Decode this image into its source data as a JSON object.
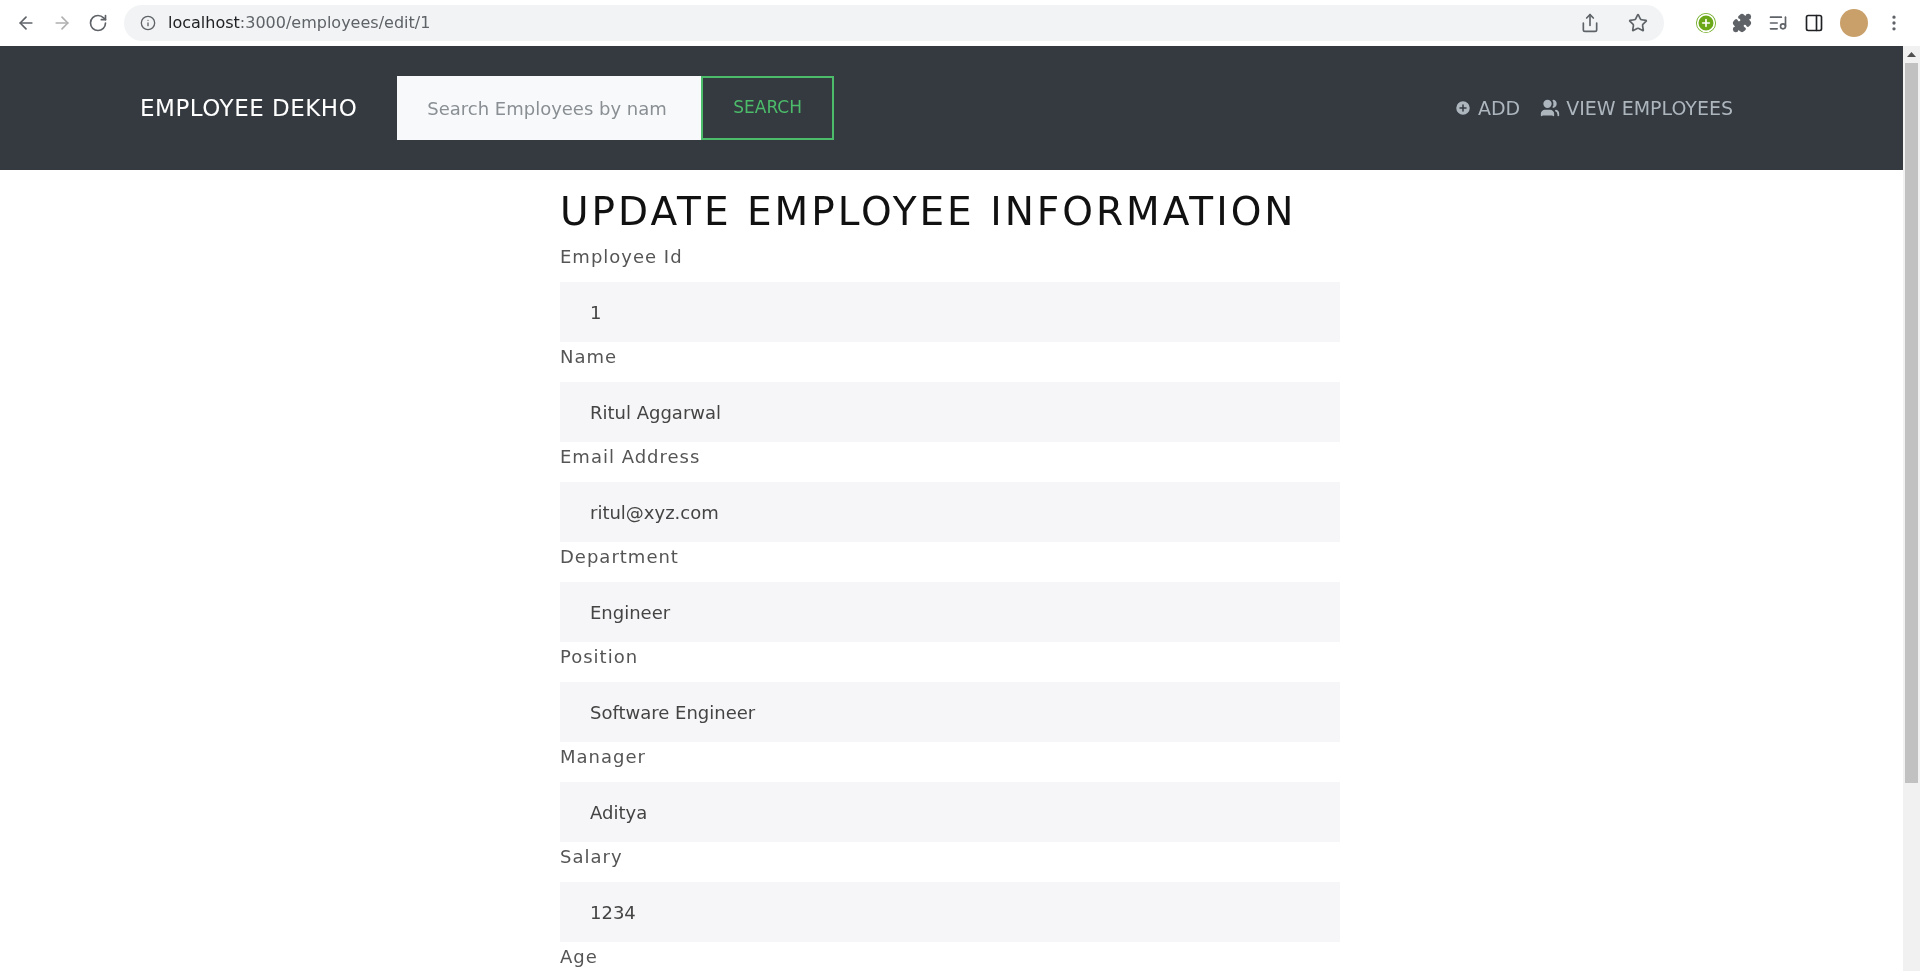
{
  "browser": {
    "url_host": "localhost",
    "url_path": ":3000/employees/edit/1",
    "back_disabled": false,
    "forward_disabled": true
  },
  "navbar": {
    "brand": "EMPLOYEE DEKHO",
    "search": {
      "placeholder": "Search Employees by nam"
    },
    "search_button": "SEARCH",
    "links": [
      {
        "kind": "add",
        "label": "ADD"
      },
      {
        "kind": "people",
        "label": "VIEW EMPLOYEES"
      }
    ]
  },
  "form": {
    "title": "UPDATE EMPLOYEE INFORMATION",
    "fields": [
      {
        "label": "Employee Id",
        "value": "1"
      },
      {
        "label": "Name",
        "value": "Ritul Aggarwal"
      },
      {
        "label": "Email Address",
        "value": "ritul@xyz.com"
      },
      {
        "label": "Department",
        "value": "Engineer"
      },
      {
        "label": "Position",
        "value": "Software Engineer"
      },
      {
        "label": "Manager",
        "value": "Aditya"
      },
      {
        "label": "Salary",
        "value": "1234"
      },
      {
        "label": "Age"
      }
    ]
  }
}
